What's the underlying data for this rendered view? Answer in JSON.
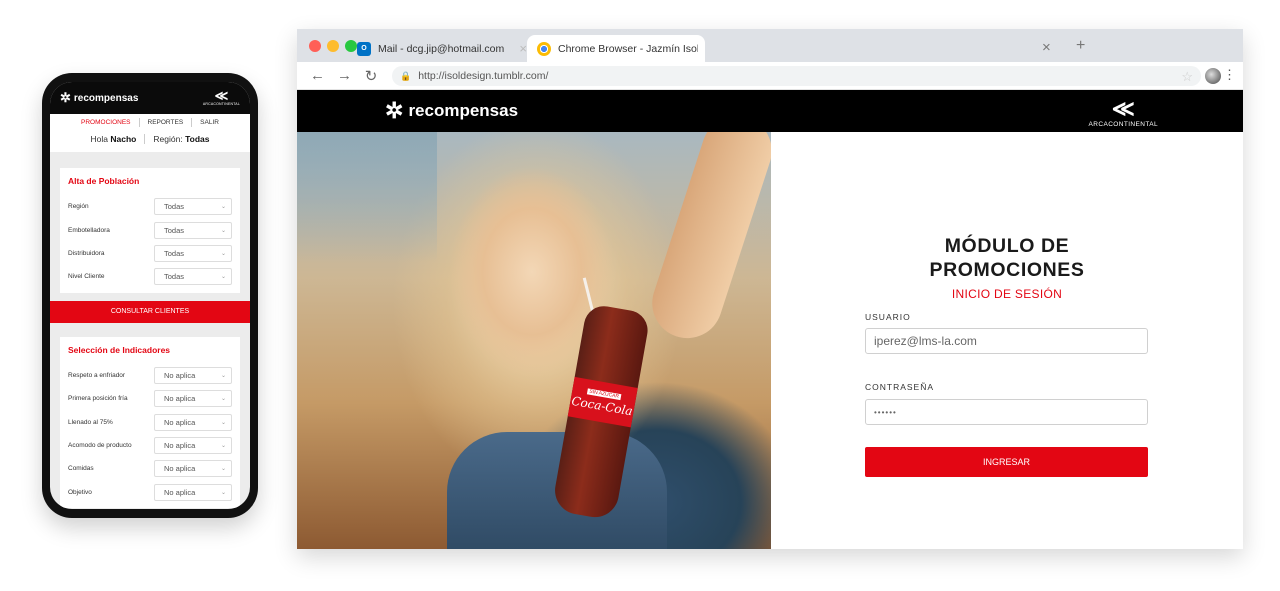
{
  "mobile": {
    "brand": "recompensas",
    "company_logo_text": "ARCACONTINENTAL",
    "nav": [
      "PROMOCIONES",
      "REPORTES",
      "SALIR"
    ],
    "greeting": "Hola",
    "user_name": "Nacho",
    "region_label": "Región:",
    "region_value": "Todas",
    "population_card": {
      "title": "Alta de Población",
      "rows": [
        {
          "label": "Región",
          "value": "Todas"
        },
        {
          "label": "Embotelladora",
          "value": "Todas"
        },
        {
          "label": "Distribuidora",
          "value": "Todas"
        },
        {
          "label": "Nivel Cliente",
          "value": "Todas"
        }
      ],
      "button": "CONSULTAR CLIENTES"
    },
    "indicators_card": {
      "title": "Selección de Indicadores",
      "rows": [
        {
          "label": "Respeto a enfriador",
          "value": "No aplica"
        },
        {
          "label": "Primera posición fría",
          "value": "No aplica"
        },
        {
          "label": "Llenado al 75%",
          "value": "No aplica"
        },
        {
          "label": "Acomodo de producto",
          "value": "No aplica"
        },
        {
          "label": "Comidas",
          "value": "No aplica"
        },
        {
          "label": "Objetivo",
          "value": "No aplica"
        }
      ]
    }
  },
  "browser": {
    "tabs": [
      {
        "title": "Mail - dcg.jip@hotmail.com",
        "icon": "outlook-icon"
      },
      {
        "title": "Chrome Browser - Jazmín Isol Prado",
        "icon": "chrome-icon"
      }
    ],
    "url": "http://isoldesign.tumblr.com/",
    "colors": {
      "red": "#ff5f57",
      "yellow": "#febc2e",
      "green": "#28c840"
    }
  },
  "site": {
    "brand": "recompensas",
    "company_logo_text": "ARCACONTINENTAL",
    "bottle_label": "Coca-Cola",
    "bottle_tag": "SIN AZÚCAR",
    "title_line1": "MÓDULO DE",
    "title_line2": "PROMOCIONES",
    "subtitle": "INICIO DE SESIÓN",
    "user_label": "USUARIO",
    "user_value": "iperez@lms-la.com",
    "password_label": "CONTRASEÑA",
    "password_value": "••••••",
    "submit": "INGRESAR",
    "accent_color": "#e30613"
  }
}
